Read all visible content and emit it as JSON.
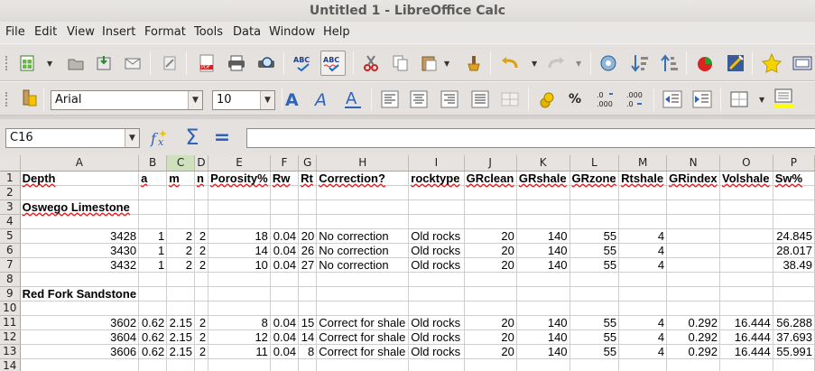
{
  "window": {
    "title": "Untitled 1 - LibreOffice Calc"
  },
  "menu": [
    "File",
    "Edit",
    "View",
    "Insert",
    "Format",
    "Tools",
    "Data",
    "Window",
    "Help"
  ],
  "format_bar": {
    "font_name": "Arial",
    "font_size": "10"
  },
  "formula_bar": {
    "name_box": "C16",
    "input": ""
  },
  "columns": [
    "A",
    "B",
    "C",
    "D",
    "E",
    "F",
    "G",
    "H",
    "I",
    "J",
    "K",
    "L",
    "M",
    "N",
    "O",
    "P"
  ],
  "selected_column": "C",
  "rows": [
    {
      "n": "1",
      "cells": [
        "Depth",
        "a",
        "m",
        "n",
        "Porosity%",
        "Rw",
        "Rt",
        "Correction?",
        "rocktype",
        "GRclean",
        "GRshale",
        "GRzone",
        "Rtshale",
        "GRindex",
        "Volshale",
        "Sw%"
      ]
    },
    {
      "n": "2",
      "cells": [
        "",
        "",
        "",
        "",
        "",
        "",
        "",
        "",
        "",
        "",
        "",
        "",
        "",
        "",
        "",
        ""
      ]
    },
    {
      "n": "3",
      "cells": [
        "Oswego Limestone",
        "",
        "",
        "",
        "",
        "",
        "",
        "",
        "",
        "",
        "",
        "",
        "",
        "",
        "",
        ""
      ]
    },
    {
      "n": "4",
      "cells": [
        "",
        "",
        "",
        "",
        "",
        "",
        "",
        "",
        "",
        "",
        "",
        "",
        "",
        "",
        "",
        ""
      ]
    },
    {
      "n": "5",
      "cells": [
        "3428",
        "1",
        "2",
        "2",
        "18",
        "0.04",
        "20",
        "No correction",
        "Old rocks",
        "20",
        "140",
        "55",
        "4",
        "",
        "",
        "24.845"
      ]
    },
    {
      "n": "6",
      "cells": [
        "3430",
        "1",
        "2",
        "2",
        "14",
        "0.04",
        "26",
        "No correction",
        "Old rocks",
        "20",
        "140",
        "55",
        "4",
        "",
        "",
        "28.017"
      ]
    },
    {
      "n": "7",
      "cells": [
        "3432",
        "1",
        "2",
        "2",
        "10",
        "0.04",
        "27",
        "No correction",
        "Old rocks",
        "20",
        "140",
        "55",
        "4",
        "",
        "",
        "38.49"
      ]
    },
    {
      "n": "8",
      "cells": [
        "",
        "",
        "",
        "",
        "",
        "",
        "",
        "",
        "",
        "",
        "",
        "",
        "",
        "",
        "",
        ""
      ]
    },
    {
      "n": "9",
      "cells": [
        "Red Fork Sandstone",
        "",
        "",
        "",
        "",
        "",
        "",
        "",
        "",
        "",
        "",
        "",
        "",
        "",
        "",
        ""
      ]
    },
    {
      "n": "10",
      "cells": [
        "",
        "",
        "",
        "",
        "",
        "",
        "",
        "",
        "",
        "",
        "",
        "",
        "",
        "",
        "",
        ""
      ]
    },
    {
      "n": "11",
      "cells": [
        "3602",
        "0.62",
        "2.15",
        "2",
        "8",
        "0.04",
        "15",
        "Correct for shale",
        "Old rocks",
        "20",
        "140",
        "55",
        "4",
        "0.292",
        "16.444",
        "56.288"
      ]
    },
    {
      "n": "12",
      "cells": [
        "3604",
        "0.62",
        "2.15",
        "2",
        "12",
        "0.04",
        "14",
        "Correct for shale",
        "Old rocks",
        "20",
        "140",
        "55",
        "4",
        "0.292",
        "16.444",
        "37.693"
      ]
    },
    {
      "n": "13",
      "cells": [
        "3606",
        "0.62",
        "2.15",
        "2",
        "11",
        "0.04",
        "8",
        "Correct for shale",
        "Old rocks",
        "20",
        "140",
        "55",
        "4",
        "0.292",
        "16.444",
        "55.991"
      ]
    },
    {
      "n": "14",
      "cells": [
        "",
        "",
        "",
        "",
        "",
        "",
        "",
        "",
        "",
        "",
        "",
        "",
        "",
        "",
        "",
        ""
      ]
    }
  ],
  "toolbar_icons": [
    "new-document-icon",
    "open-icon",
    "save-icon",
    "email-icon",
    "edit-file-icon",
    "export-pdf-icon",
    "print-icon",
    "print-preview-icon",
    "spellcheck-icon",
    "autospellcheck-icon",
    "cut-icon",
    "copy-icon",
    "paste-icon",
    "clone-formatting-icon",
    "undo-icon",
    "redo-icon",
    "navigator-icon",
    "sort-ascending-icon",
    "sort-descending-icon",
    "chart-icon",
    "draw-functions-icon",
    "gallery-icon",
    "datasource-icon"
  ],
  "format_icons": [
    "font-color-icon",
    "bold-icon",
    "italic-icon",
    "underline-icon",
    "align-left-icon",
    "align-center-icon",
    "align-right-icon",
    "justify-icon",
    "merge-cells-icon",
    "currency-icon",
    "percent-icon",
    "add-decimal-icon",
    "remove-decimal-icon",
    "decrease-indent-icon",
    "increase-indent-icon",
    "borders-icon",
    "background-color-icon"
  ],
  "colors": {
    "selected_header": "#cfe0bd",
    "header_bg": "#e6e3e0",
    "toolbar_bg": "#e4e1de"
  }
}
